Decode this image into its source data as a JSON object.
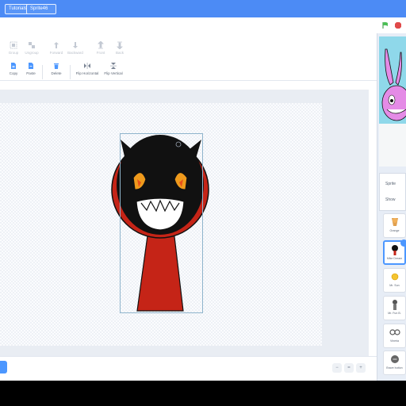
{
  "topbar": {
    "tabs": [
      "Tutorials",
      "Sprite46"
    ]
  },
  "toolbar": {
    "row1": [
      "Group",
      "Ungroup",
      "Forward",
      "Backward",
      "Front",
      "Back"
    ],
    "row2": [
      "Copy",
      "Paste",
      "Delete",
      "Flip Horizontal",
      "Flip Vertical"
    ]
  },
  "bottombar": {
    "zoom_out": "−",
    "zoom_reset": "=",
    "zoom_in": "+"
  },
  "sprite_info": {
    "sprite_label": "Sprite",
    "show_label": "Show"
  },
  "sprites": [
    {
      "name": "Orange"
    },
    {
      "name": "Mike Dream"
    },
    {
      "name": "Mr. Sun"
    },
    {
      "name": "Mr. Fun B."
    },
    {
      "name": "Vineria"
    },
    {
      "name": "Brave button"
    }
  ],
  "colors": {
    "accent": "#4c97ff",
    "topbar": "#4c8bf5",
    "character_red": "#c52417",
    "character_black": "#111111",
    "eye_orange": "#ef9a1c"
  }
}
